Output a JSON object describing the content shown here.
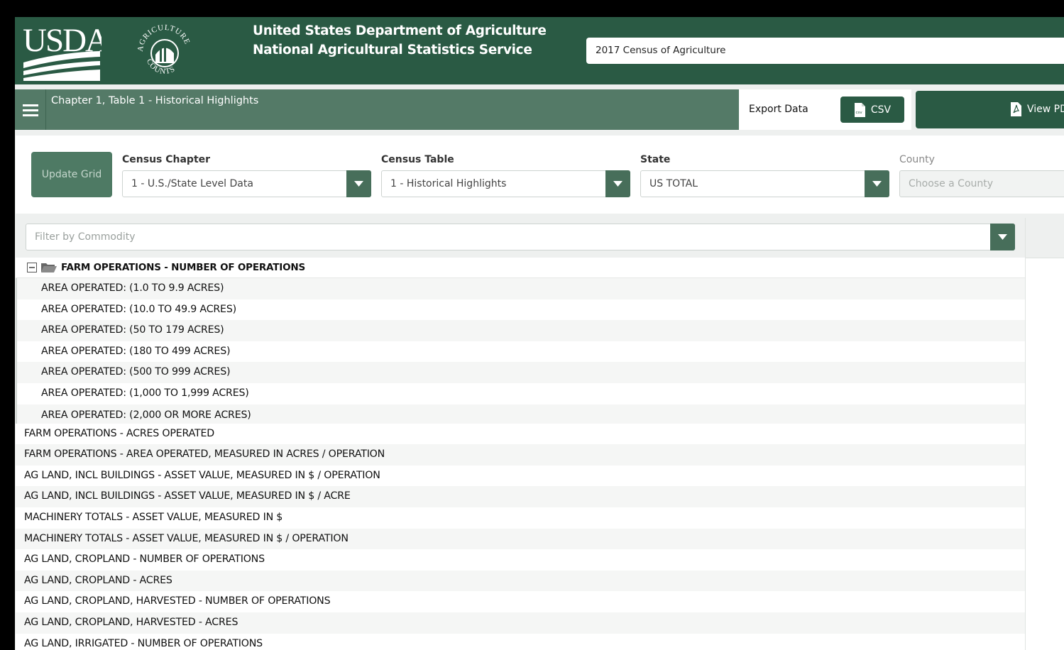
{
  "header": {
    "logo_text": "USDA",
    "seal_text_top": "AGRICULTURE",
    "seal_text_bottom": "COUNTS",
    "agency_line1": "United States Department of Agriculture",
    "agency_line2": "National Agricultural Statistics Service",
    "census_selection": "2017 Census of Agriculture"
  },
  "toolbar": {
    "chapter_title": "Chapter 1, Table 1 - Historical Highlights",
    "export_label": "Export Data",
    "csv_label": "CSV",
    "view_pdf_label": "View PDF"
  },
  "filters": {
    "update_label": "Update Grid",
    "census_chapter": {
      "label": "Census Chapter",
      "value": "1 - U.S./State Level Data"
    },
    "census_table": {
      "label": "Census Table",
      "value": "1 - Historical Highlights"
    },
    "state": {
      "label": "State",
      "value": "US TOTAL"
    },
    "county": {
      "label": "County",
      "placeholder": "Choose a County"
    },
    "commodity_placeholder": "Filter by Commodity"
  },
  "grid": {
    "group_label": "FARM OPERATIONS - NUMBER OF OPERATIONS",
    "children": [
      "AREA OPERATED: (1.0 TO 9.9 ACRES)",
      "AREA OPERATED: (10.0 TO 49.9 ACRES)",
      "AREA OPERATED: (50 TO 179 ACRES)",
      "AREA OPERATED: (180 TO 499 ACRES)",
      "AREA OPERATED: (500 TO 999 ACRES)",
      "AREA OPERATED: (1,000 TO 1,999 ACRES)",
      "AREA OPERATED: (2,000 OR MORE ACRES)"
    ],
    "rows": [
      "FARM OPERATIONS - ACRES OPERATED",
      "FARM OPERATIONS - AREA OPERATED, MEASURED IN ACRES / OPERATION",
      "AG LAND, INCL BUILDINGS - ASSET VALUE, MEASURED IN $ / OPERATION",
      "AG LAND, INCL BUILDINGS - ASSET VALUE, MEASURED IN $ / ACRE",
      "MACHINERY TOTALS - ASSET VALUE, MEASURED IN $",
      "MACHINERY TOTALS - ASSET VALUE, MEASURED IN $ / OPERATION",
      "AG LAND, CROPLAND - NUMBER OF OPERATIONS",
      "AG LAND, CROPLAND - ACRES",
      "AG LAND, CROPLAND, HARVESTED - NUMBER OF OPERATIONS",
      "AG LAND, CROPLAND, HARVESTED - ACRES",
      "AG LAND, IRRIGATED - NUMBER OF OPERATIONS"
    ]
  },
  "colors": {
    "header_green": "#2a5a44",
    "bar_green": "#547a67",
    "button_green": "#4e7a64",
    "caret_green": "#476e5a"
  }
}
